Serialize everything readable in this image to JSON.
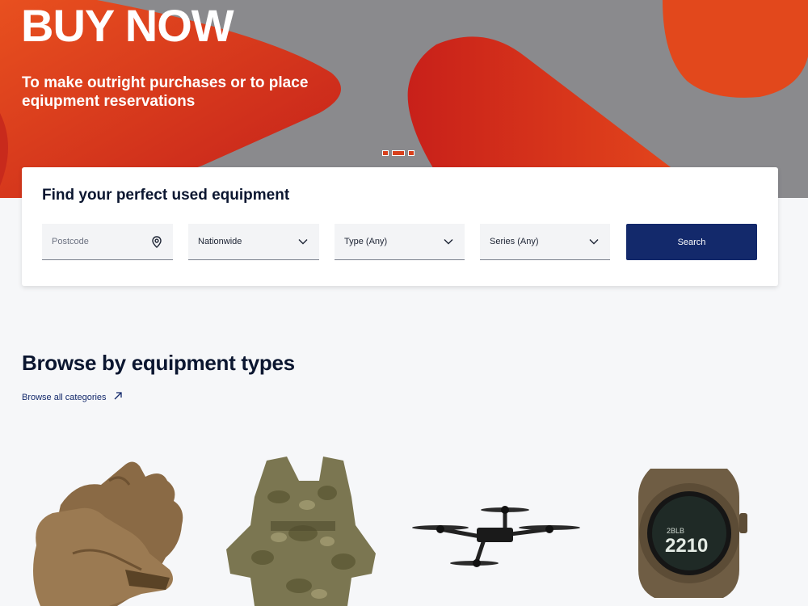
{
  "hero": {
    "title": "BUY NOW",
    "subtitle": "To make outright purchases or to place eqiupment reservations",
    "background_color": "#8a8a8d",
    "accent_color": "#e3421d",
    "slides": [
      {
        "active": false
      },
      {
        "active": true
      },
      {
        "active": false
      }
    ]
  },
  "search": {
    "title": "Find your perfect used equipment",
    "postcode": {
      "placeholder": "Postcode",
      "icon": "location-pin-icon"
    },
    "distance": {
      "value": "Nationwide",
      "icon": "chevron-down-icon"
    },
    "type": {
      "value": "Type (Any)",
      "icon": "chevron-down-icon"
    },
    "series": {
      "value": "Series (Any)",
      "icon": "chevron-down-icon"
    },
    "button_label": "Search",
    "button_color": "#13296b"
  },
  "browse": {
    "title": "Browse by equipment types",
    "link_label": "Browse all categories",
    "link_icon": "arrow-up-right-icon",
    "categories": [
      {
        "icon": "tactical-gloves-image"
      },
      {
        "icon": "plate-carrier-vest-image"
      },
      {
        "icon": "fpv-drone-image"
      },
      {
        "icon": "smartwatch-image"
      }
    ]
  }
}
